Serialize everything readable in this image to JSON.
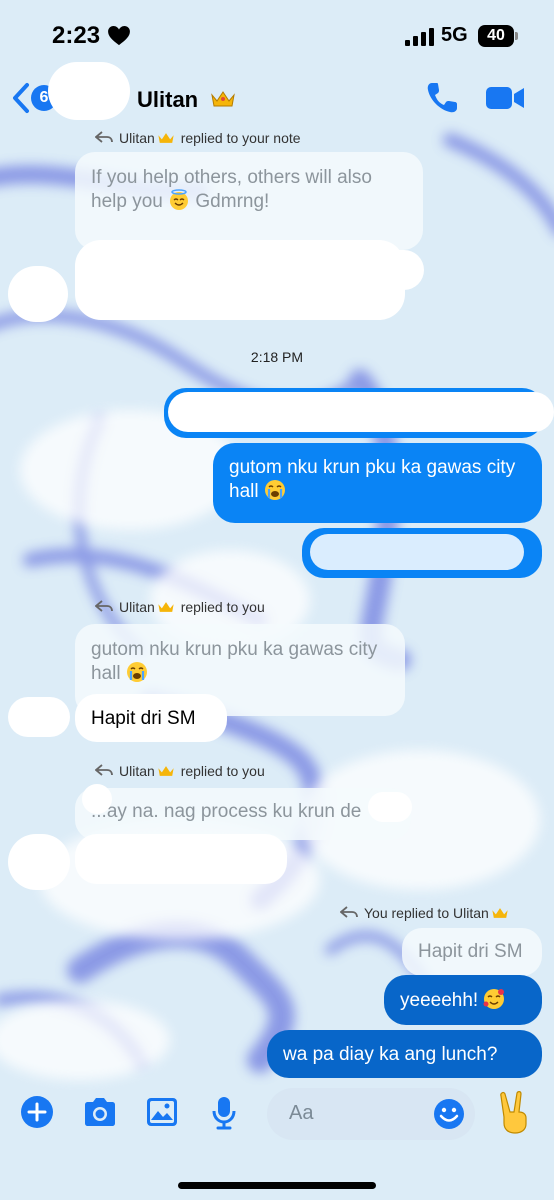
{
  "status_bar": {
    "time": "2:23",
    "network": "5G",
    "battery": "40"
  },
  "header": {
    "back_count": "6",
    "contact_name": "Ulitan"
  },
  "messages": {
    "reply_note_label": "Ulitan",
    "reply_note_suffix": "replied to your note",
    "note_quote": "If you help others, others will also help you",
    "note_quote_end": "Gdmrng!",
    "timestamp": "2:18 PM",
    "out1": "gutom nku krun pku ka gawas city hall",
    "reply_you_label": "Ulitan",
    "reply_you_suffix": "replied to you",
    "quote2": "gutom nku krun pku ka gawas city hall",
    "in2": "Hapit dri SM",
    "reply_you2_label": "Ulitan",
    "reply_you2_suffix": "replied to you",
    "quote3": "...ay na. nag process ku krun de",
    "my_reply_prefix": "You replied to Ulitan",
    "quote4": "Hapit dri SM",
    "out4": "yeeeehh!",
    "out5": "wa pa diay ka ang lunch?"
  },
  "composer": {
    "placeholder": "Aa"
  },
  "colors": {
    "accent": "#1877f2",
    "outgoing": "#0a84f5",
    "outgoing_dark": "#0866c9"
  }
}
